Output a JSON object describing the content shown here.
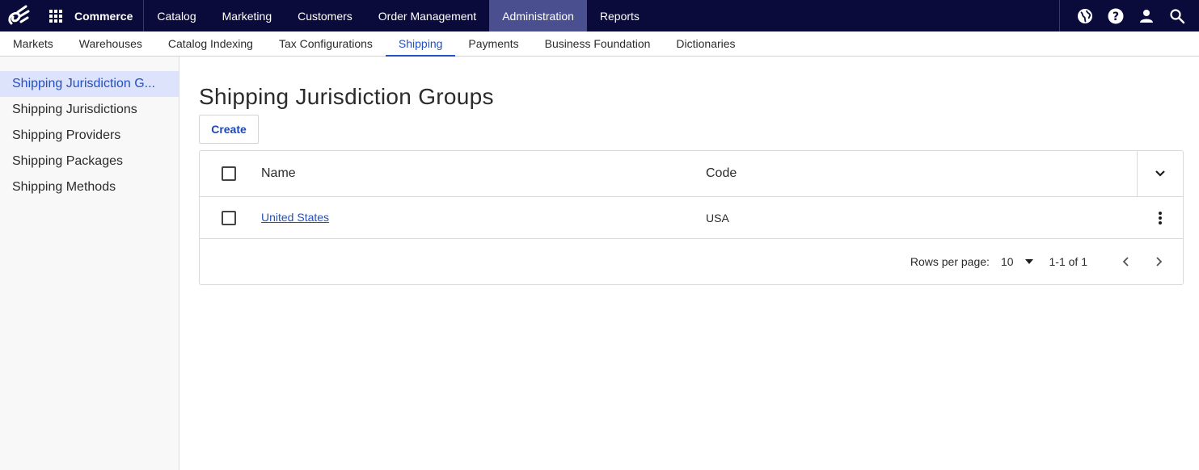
{
  "topbar": {
    "product": "Commerce",
    "nav": [
      {
        "label": "Catalog",
        "active": false
      },
      {
        "label": "Marketing",
        "active": false
      },
      {
        "label": "Customers",
        "active": false
      },
      {
        "label": "Order Management",
        "active": false
      },
      {
        "label": "Administration",
        "active": true
      },
      {
        "label": "Reports",
        "active": false
      }
    ],
    "icons": [
      "globe-icon",
      "help-icon",
      "user-icon",
      "search-icon"
    ]
  },
  "subnav": {
    "items": [
      {
        "label": "Markets",
        "active": false
      },
      {
        "label": "Warehouses",
        "active": false
      },
      {
        "label": "Catalog Indexing",
        "active": false
      },
      {
        "label": "Tax Configurations",
        "active": false
      },
      {
        "label": "Shipping",
        "active": true
      },
      {
        "label": "Payments",
        "active": false
      },
      {
        "label": "Business Foundation",
        "active": false
      },
      {
        "label": "Dictionaries",
        "active": false
      }
    ]
  },
  "sidebar": {
    "items": [
      {
        "label": "Shipping Jurisdiction G...",
        "active": true
      },
      {
        "label": "Shipping Jurisdictions",
        "active": false
      },
      {
        "label": "Shipping Providers",
        "active": false
      },
      {
        "label": "Shipping Packages",
        "active": false
      },
      {
        "label": "Shipping Methods",
        "active": false
      }
    ]
  },
  "main": {
    "title": "Shipping Jurisdiction Groups",
    "create_label": "Create",
    "table": {
      "columns": [
        "Name",
        "Code"
      ],
      "rows": [
        {
          "name": "United States",
          "code": "USA"
        }
      ]
    },
    "pagination": {
      "rows_per_page_label": "Rows per page:",
      "rows_per_page_value": "10",
      "range": "1-1 of 1"
    }
  },
  "colors": {
    "topbar_bg": "#0b0b3b",
    "topbar_active": "#4a4f8f",
    "accent": "#2350c2",
    "sidebar_active_bg": "#dde3fa"
  }
}
